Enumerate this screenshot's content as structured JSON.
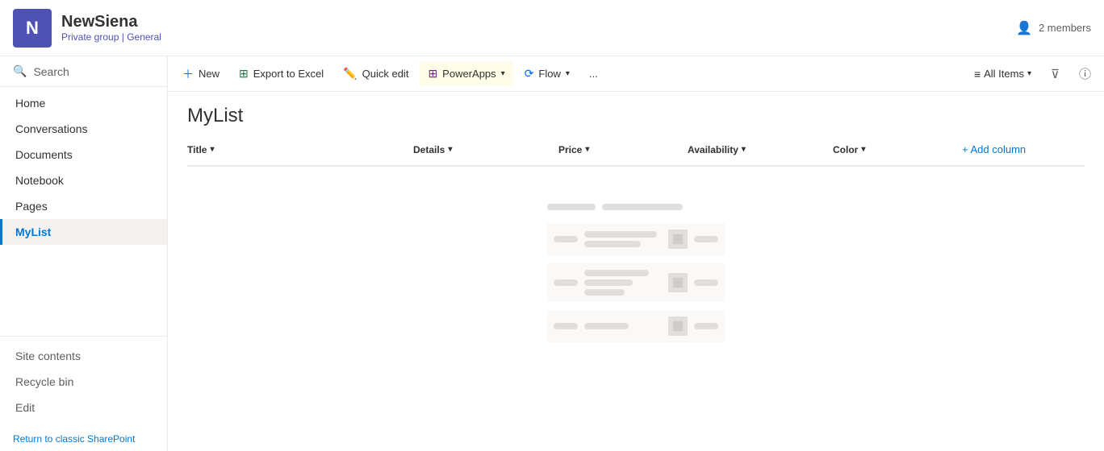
{
  "header": {
    "app_initial": "N",
    "site_name": "NewSiena",
    "site_group": "Private group",
    "separator": "|",
    "channel": "General",
    "members_label": "2 members"
  },
  "sidebar": {
    "search_label": "Search",
    "nav_items": [
      {
        "id": "home",
        "label": "Home",
        "active": false
      },
      {
        "id": "conversations",
        "label": "Conversations",
        "active": false
      },
      {
        "id": "documents",
        "label": "Documents",
        "active": false
      },
      {
        "id": "notebook",
        "label": "Notebook",
        "active": false
      },
      {
        "id": "pages",
        "label": "Pages",
        "active": false
      },
      {
        "id": "mylist",
        "label": "MyList",
        "active": true
      }
    ],
    "bottom_items": [
      {
        "id": "site-contents",
        "label": "Site contents"
      },
      {
        "id": "recycle-bin",
        "label": "Recycle bin"
      },
      {
        "id": "edit",
        "label": "Edit"
      }
    ],
    "return_link": "Return to classic SharePoint"
  },
  "toolbar": {
    "new_label": "New",
    "export_label": "Export to Excel",
    "quick_edit_label": "Quick edit",
    "power_apps_label": "PowerApps",
    "flow_label": "Flow",
    "more_label": "...",
    "view_label": "All Items",
    "filter_label": "Filter",
    "info_label": "Info"
  },
  "list": {
    "title": "MyList",
    "columns": [
      {
        "id": "title",
        "label": "Title"
      },
      {
        "id": "details",
        "label": "Details"
      },
      {
        "id": "price",
        "label": "Price"
      },
      {
        "id": "availability",
        "label": "Availability"
      },
      {
        "id": "color",
        "label": "Color"
      }
    ],
    "add_column_label": "+ Add column"
  }
}
